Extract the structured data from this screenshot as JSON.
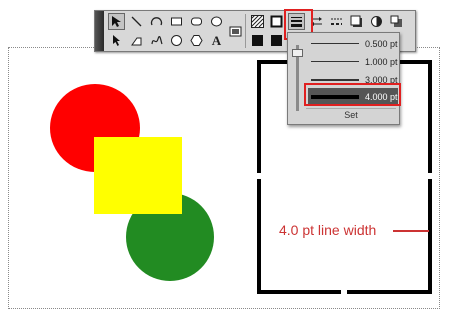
{
  "toolbar": {
    "text_tool_glyph": "A"
  },
  "line_width_menu": {
    "options": [
      "0.500 pt",
      "1.000 pt",
      "3.000 pt",
      "4.000 pt"
    ],
    "selected_label": "4.000 pt",
    "set_label": "Set"
  },
  "canvas": {
    "annotation": "4.0 pt line width",
    "colors": {
      "circle_top": "#ff0000",
      "square": "#ffff00",
      "circle_bottom": "#228b22",
      "annotation": "#cc3333",
      "highlight": "#e02020"
    }
  }
}
